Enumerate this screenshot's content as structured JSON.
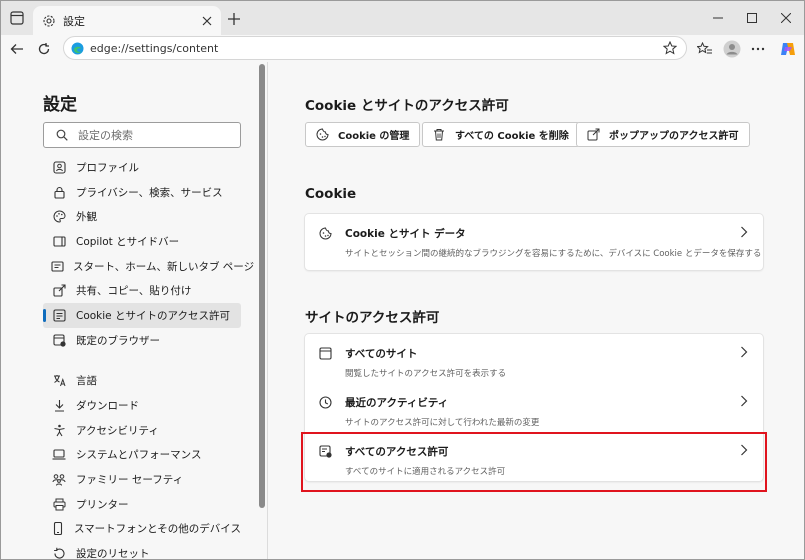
{
  "tab": {
    "title": "設定"
  },
  "address": {
    "url": "edge://settings/content"
  },
  "sidebar": {
    "title": "設定",
    "search_placeholder": "設定の検索",
    "items": [
      {
        "label": "プロファイル",
        "icon": "profile-icon"
      },
      {
        "label": "プライバシー、検索、サービス",
        "icon": "lock-icon"
      },
      {
        "label": "外観",
        "icon": "palette-icon"
      },
      {
        "label": "Copilot とサイドバー",
        "icon": "sidebar-icon"
      },
      {
        "label": "スタート、ホーム、新しいタブ ページ",
        "icon": "home-tab-icon"
      },
      {
        "label": "共有、コピー、貼り付け",
        "icon": "share-icon"
      },
      {
        "label": "Cookie とサイトのアクセス許可",
        "icon": "cookie-permissions-icon",
        "active": true
      },
      {
        "label": "既定のブラウザー",
        "icon": "default-browser-icon"
      },
      {
        "label": "言語",
        "icon": "language-icon"
      },
      {
        "label": "ダウンロード",
        "icon": "download-icon"
      },
      {
        "label": "アクセシビリティ",
        "icon": "accessibility-icon"
      },
      {
        "label": "システムとパフォーマンス",
        "icon": "laptop-icon"
      },
      {
        "label": "ファミリー セーフティ",
        "icon": "family-icon"
      },
      {
        "label": "プリンター",
        "icon": "printer-icon"
      },
      {
        "label": "スマートフォンとその他のデバイス",
        "icon": "phone-icon"
      },
      {
        "label": "設定のリセット",
        "icon": "reset-icon"
      }
    ]
  },
  "main": {
    "section1_title": "Cookie とサイトのアクセス許可",
    "buttons": [
      {
        "label": "Cookie の管理",
        "icon": "cookie-icon"
      },
      {
        "label": "すべての Cookie を削除",
        "icon": "trash-icon"
      },
      {
        "label": "ポップアップのアクセス許可",
        "icon": "popup-icon"
      }
    ],
    "section2_title": "Cookie",
    "cookie_row": {
      "title": "Cookie とサイト データ",
      "subtitle": "サイトとセッション間の継続的なブラウジングを容易にするために、デバイスに Cookie とデータを保存する"
    },
    "section3_title": "サイトのアクセス許可",
    "permission_rows": [
      {
        "title": "すべてのサイト",
        "subtitle": "閲覧したサイトのアクセス許可を表示する",
        "icon": "site-icon"
      },
      {
        "title": "最近のアクティビティ",
        "subtitle": "サイトのアクセス許可に対して行われた最新の変更",
        "icon": "clock-icon"
      },
      {
        "title": "すべてのアクセス許可",
        "subtitle": "すべてのサイトに適用されるアクセス許可",
        "icon": "permissions-icon"
      }
    ]
  },
  "colors": {
    "accent": "#0f6cbd",
    "highlight": "#e0141e"
  }
}
